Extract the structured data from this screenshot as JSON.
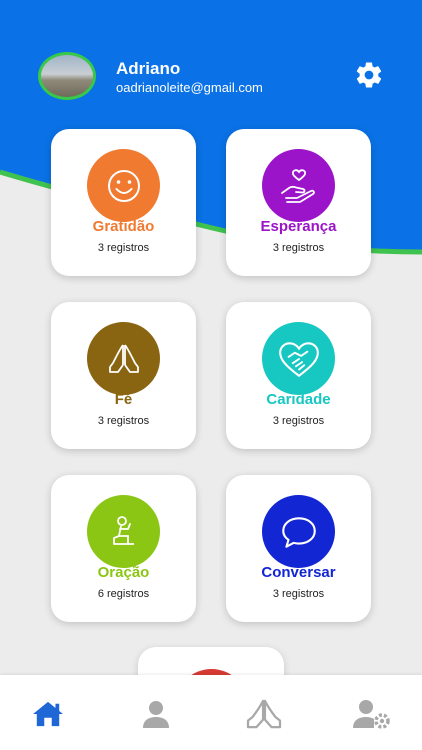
{
  "user": {
    "name": "Adriano",
    "email": "oadrianoleite@gmail.com"
  },
  "colors": {
    "header_blue": "#0a72e6",
    "wave_green": "#3fc24e",
    "background": "#ececec"
  },
  "cards": [
    {
      "title": "Gratidão",
      "count": "3 registros",
      "color": "#f07a30",
      "icon": "smile-icon"
    },
    {
      "title": "Esperança",
      "count": "3 registros",
      "color": "#9b14c9",
      "icon": "hand-heart-icon"
    },
    {
      "title": "Fé",
      "count": "3 registros",
      "color": "#8a6511",
      "icon": "praying-hands-icon"
    },
    {
      "title": "Caridade",
      "count": "3 registros",
      "color": "#17c7c1",
      "icon": "handshake-heart-icon"
    },
    {
      "title": "Oração",
      "count": "6 registros",
      "color": "#8ac613",
      "icon": "kneeling-prayer-icon"
    },
    {
      "title": "Conversar",
      "count": "3 registros",
      "color": "#1226d3",
      "icon": "speech-bubble-icon"
    }
  ],
  "bottom_nav": [
    {
      "icon": "home-icon",
      "active": true
    },
    {
      "icon": "user-icon",
      "active": false
    },
    {
      "icon": "praying-hands-icon",
      "active": false
    },
    {
      "icon": "user-settings-icon",
      "active": false
    }
  ]
}
